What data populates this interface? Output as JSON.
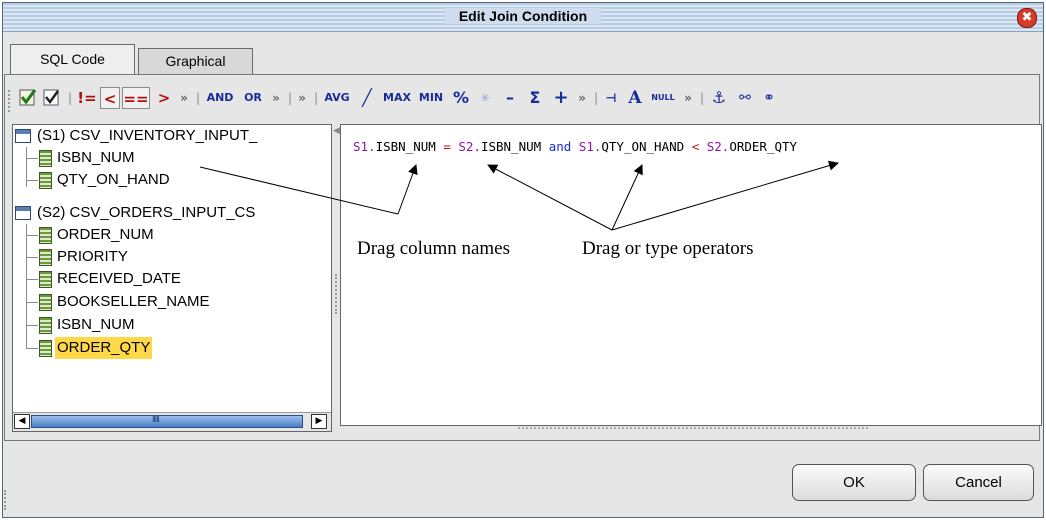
{
  "window": {
    "title": "Edit Join Condition",
    "close_glyph": "✖"
  },
  "tabs": [
    {
      "label": "SQL Code",
      "active": true
    },
    {
      "label": "Graphical",
      "active": false
    }
  ],
  "toolbar": {
    "ops": {
      "not_equal": "!=",
      "less": "<",
      "equal": "==",
      "greater": ">",
      "and": "AND",
      "or": "OR",
      "avg": "AVG",
      "max": "MAX",
      "min": "MIN",
      "percent": "%",
      "minus": "–",
      "sum": "Σ",
      "plus": "+",
      "null": "NULL",
      "more": "»",
      "sep": "|"
    }
  },
  "tree": {
    "groups": [
      {
        "label": "(S1) CSV_INVENTORY_INPUT_",
        "columns": [
          "ISBN_NUM",
          "QTY_ON_HAND"
        ]
      },
      {
        "label": "(S2) CSV_ORDERS_INPUT_CS",
        "columns": [
          "ORDER_NUM",
          "PRIORITY",
          "RECEIVED_DATE",
          "BOOKSELLER_NAME",
          "ISBN_NUM",
          "ORDER_QTY"
        ]
      }
    ],
    "selected": "ORDER_QTY"
  },
  "editor": {
    "tokens": [
      {
        "text": "S1.",
        "cls": "k-tbl"
      },
      {
        "text": "ISBN_NUM ",
        "cls": "k-col"
      },
      {
        "text": "= ",
        "cls": "k-op"
      },
      {
        "text": "S2.",
        "cls": "k-tbl"
      },
      {
        "text": "ISBN_NUM ",
        "cls": "k-col"
      },
      {
        "text": "and ",
        "cls": "k-kw"
      },
      {
        "text": "S1.",
        "cls": "k-tbl"
      },
      {
        "text": "QTY_ON_HAND ",
        "cls": "k-col"
      },
      {
        "text": "< ",
        "cls": "k-op"
      },
      {
        "text": "S2.",
        "cls": "k-tbl"
      },
      {
        "text": "ORDER_QTY",
        "cls": "k-col"
      }
    ]
  },
  "annotations": {
    "drag_columns": "Drag column names",
    "drag_operators": "Drag or type operators"
  },
  "buttons": {
    "ok": "OK",
    "cancel": "Cancel"
  },
  "colors": {
    "highlight": "#ffd84a",
    "table_prefix": "#8a1aa6",
    "operator": "#c41010",
    "keyword": "#1a2ad8"
  }
}
